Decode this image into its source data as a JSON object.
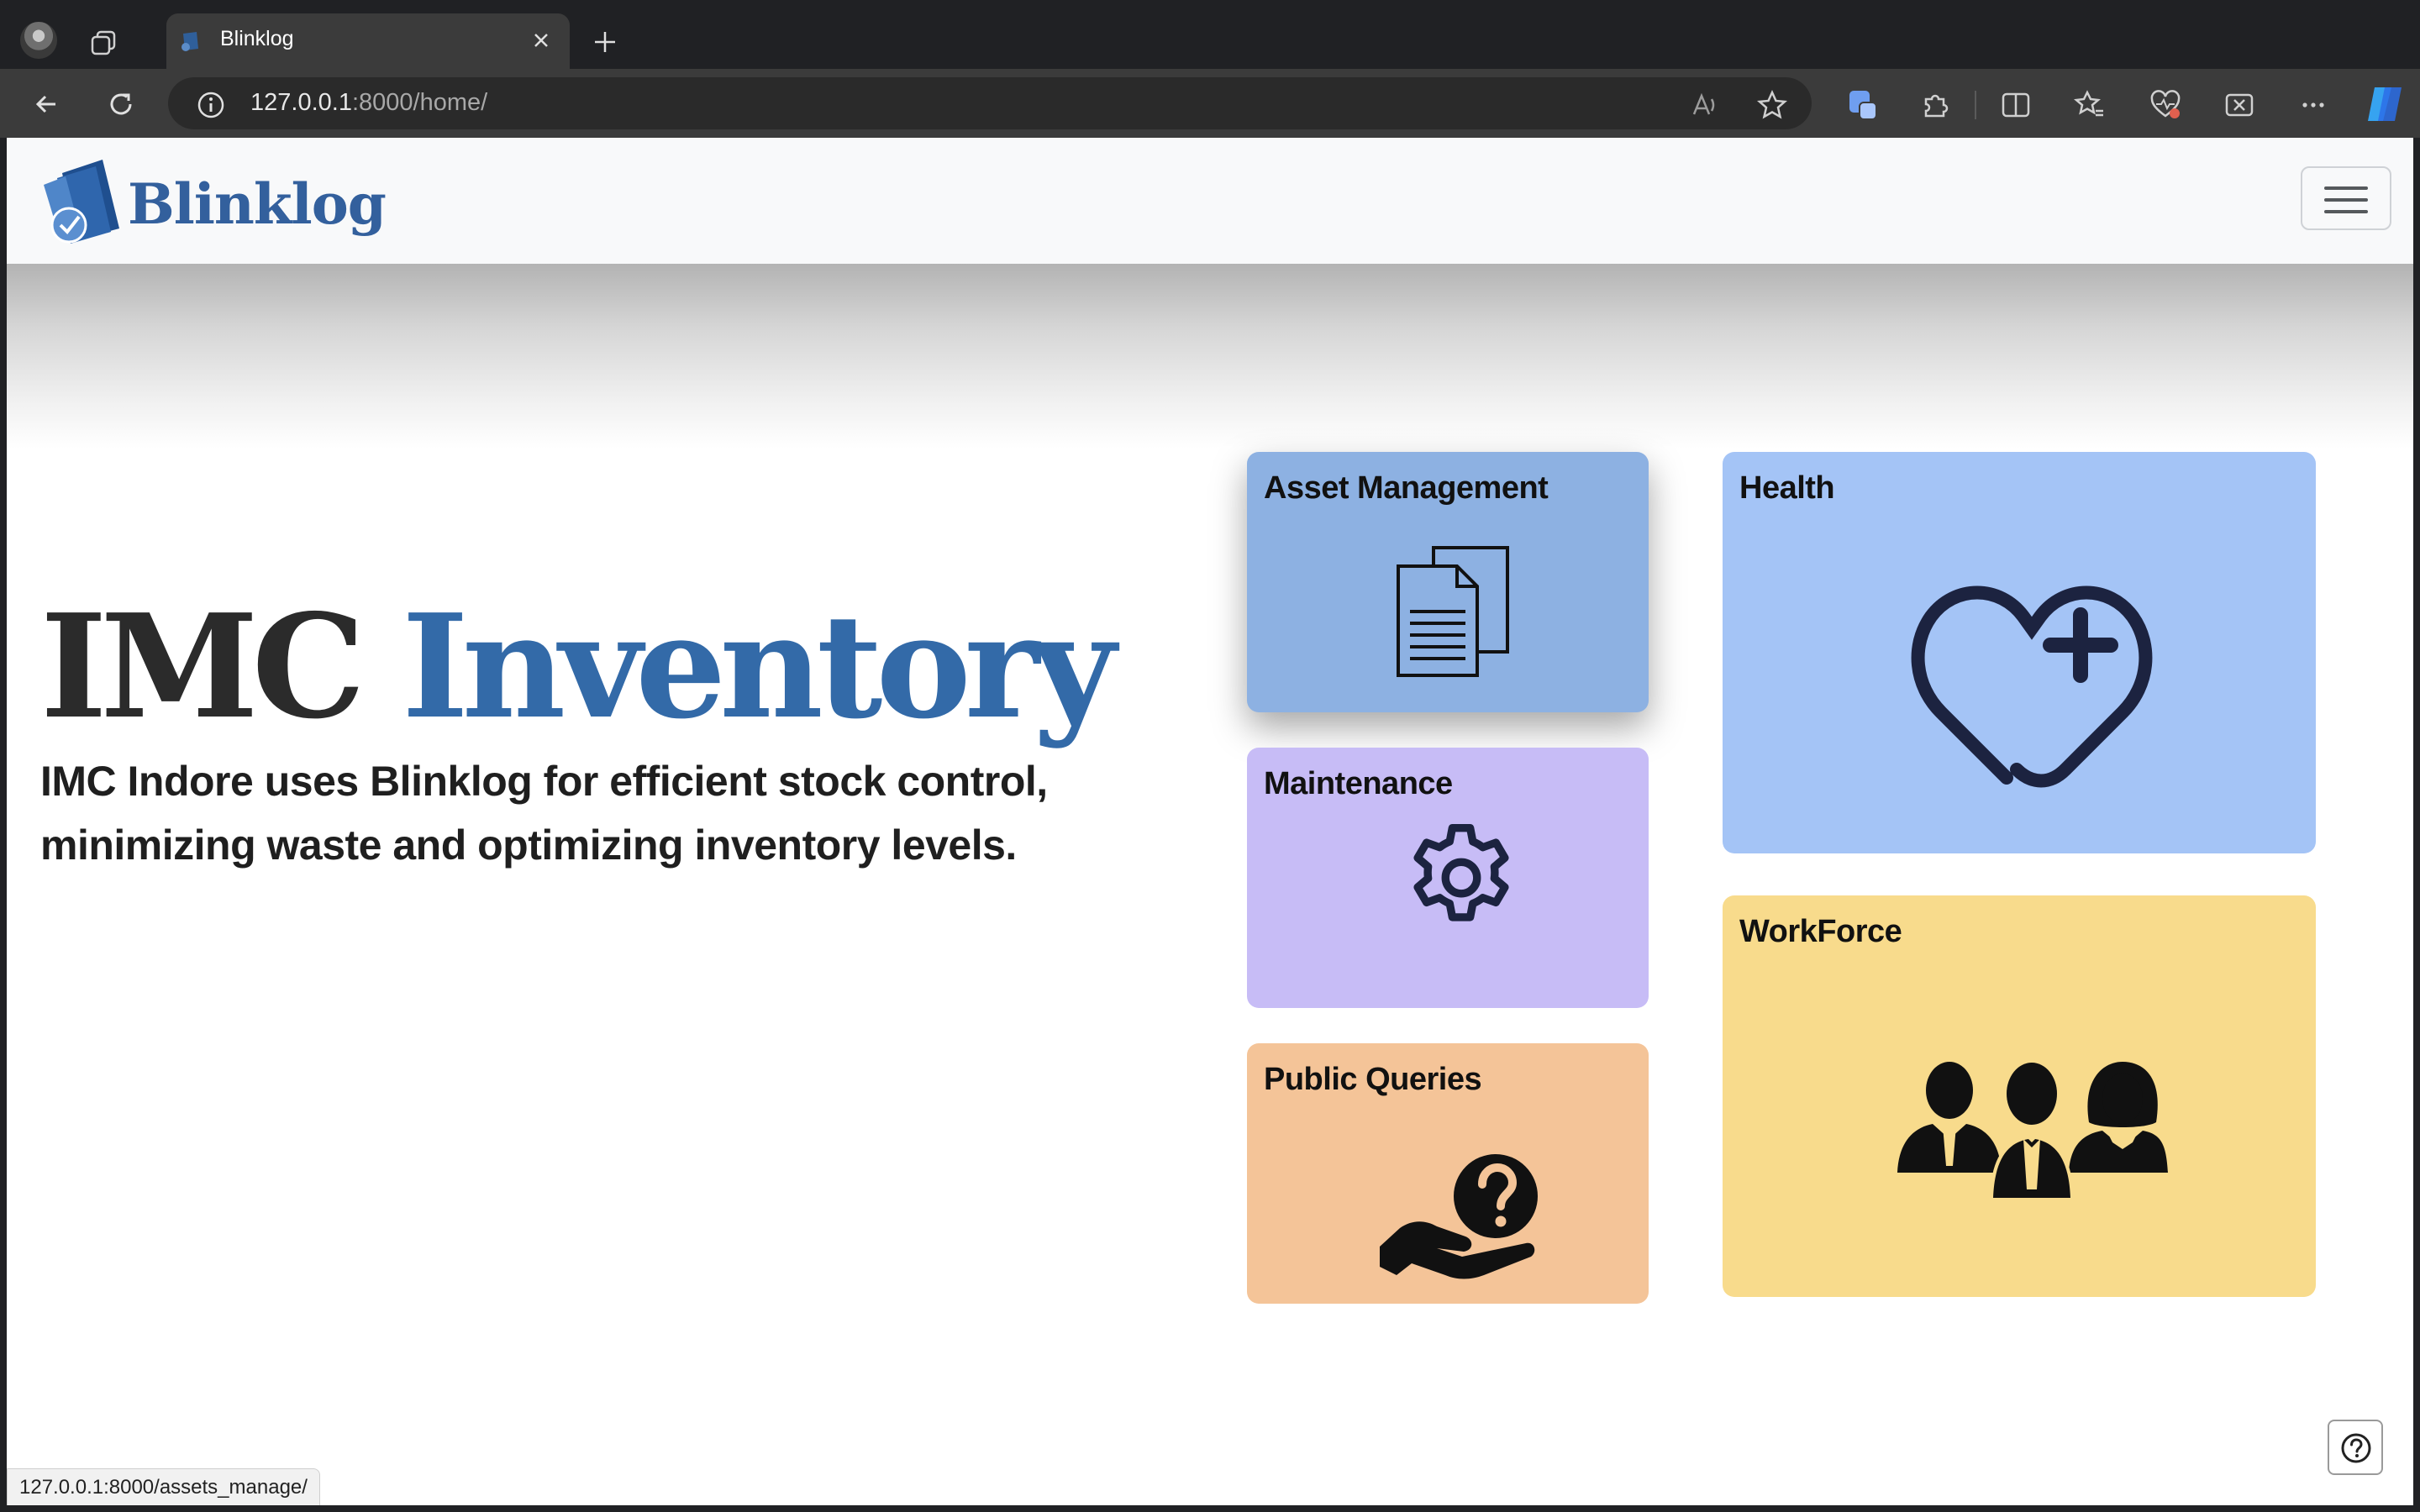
{
  "browser": {
    "tab_title": "Blinklog",
    "address_host": "127.0.0.1",
    "address_rest": ":8000/home/",
    "status_url": "127.0.0.1:8000/assets_manage/"
  },
  "brand": {
    "name": "Blinklog"
  },
  "hero": {
    "title_part1": "IMC",
    "title_part2": "Inventory",
    "description": "IMC Indore uses Blinklog for efficient stock control, minimizing waste and optimizing inventory levels."
  },
  "cards": {
    "asset": {
      "title": "Asset Management",
      "icon": "documents-icon",
      "color": "#8db1e2"
    },
    "health": {
      "title": "Health",
      "icon": "heart-plus-icon",
      "color": "#a4c4f6"
    },
    "maintenance": {
      "title": "Maintenance",
      "icon": "gear-icon",
      "color": "#c7bcf6"
    },
    "workforce": {
      "title": "WorkForce",
      "icon": "people-icon",
      "color": "#f8db8c"
    },
    "public": {
      "title": "Public Queries",
      "icon": "hand-question-icon",
      "color": "#f4c498"
    }
  },
  "colors": {
    "brand_blue": "#336aa8",
    "navbar_bg": "#f8f9fa"
  }
}
